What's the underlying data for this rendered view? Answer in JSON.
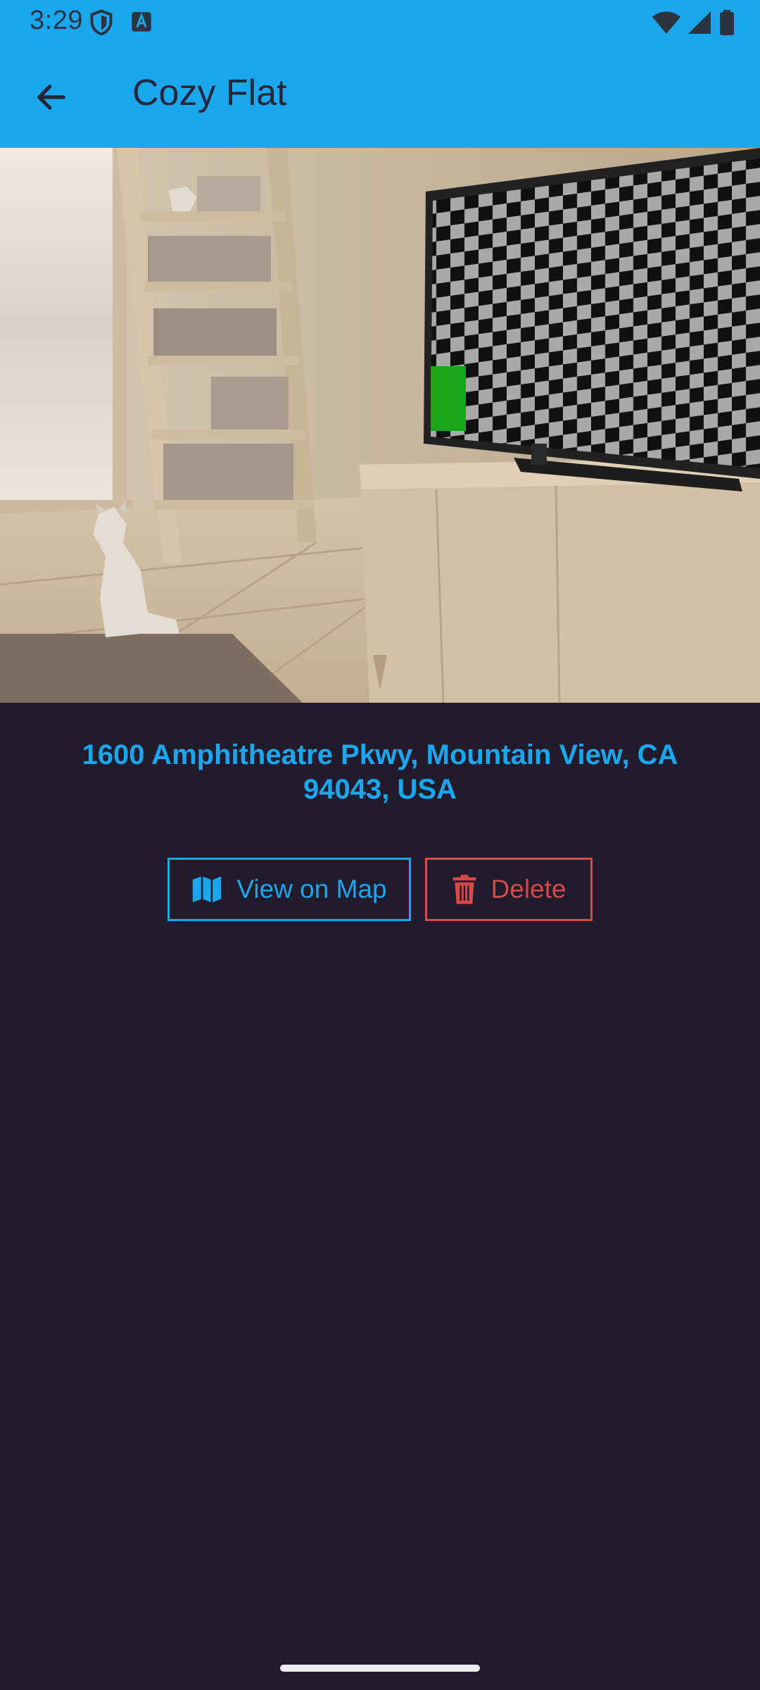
{
  "status_bar": {
    "time": "3:29",
    "icons": [
      "shield-icon",
      "a-icon",
      "wifi-icon",
      "signal-icon",
      "battery-icon"
    ]
  },
  "app_bar": {
    "back_icon": "arrow-left-icon",
    "title": "Cozy Flat"
  },
  "place": {
    "image_alt": "Living room with bookshelf ladder, low-poly cat and TV showing checkerboard",
    "address": "1600 Amphitheatre Pkwy, Mountain View, CA 94043, USA"
  },
  "actions": {
    "view_on_map": {
      "label": "View on Map",
      "icon": "map-icon"
    },
    "delete": {
      "label": "Delete",
      "icon": "trash-icon"
    }
  },
  "colors": {
    "accent": "#1aa7ee",
    "background": "#201b2d",
    "danger": "#d64a48"
  }
}
